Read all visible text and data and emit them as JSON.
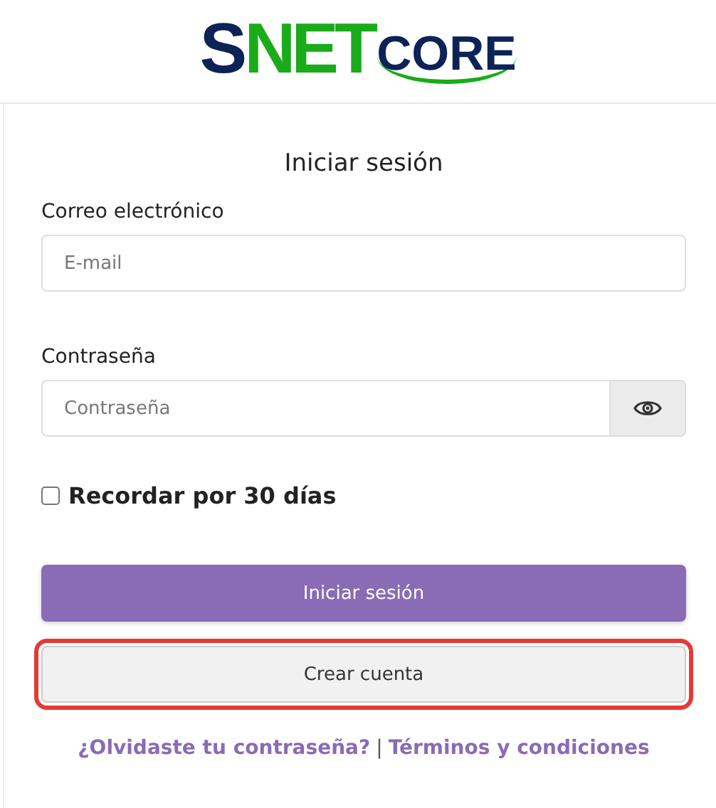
{
  "logo": {
    "parts": [
      {
        "text": "S",
        "color": "#0d2356"
      },
      {
        "text": "NET",
        "color": "#1aab1a"
      },
      {
        "text": "CORE",
        "color": "#0d2356"
      }
    ]
  },
  "login": {
    "title": "Iniciar sesión",
    "email": {
      "label": "Correo electrónico",
      "placeholder": "E-mail"
    },
    "password": {
      "label": "Contraseña",
      "placeholder": "Contraseña"
    },
    "remember": {
      "label": "Recordar por 30 días",
      "checked": false
    },
    "buttons": [
      {
        "label": "Iniciar sesión",
        "kind": "primary",
        "highlighted": false
      },
      {
        "label": "Crear cuenta",
        "kind": "secondary",
        "highlighted": true
      }
    ],
    "links": [
      "¿Olvidaste tu contraseña?",
      "Términos y condiciones"
    ],
    "separator": "|"
  }
}
